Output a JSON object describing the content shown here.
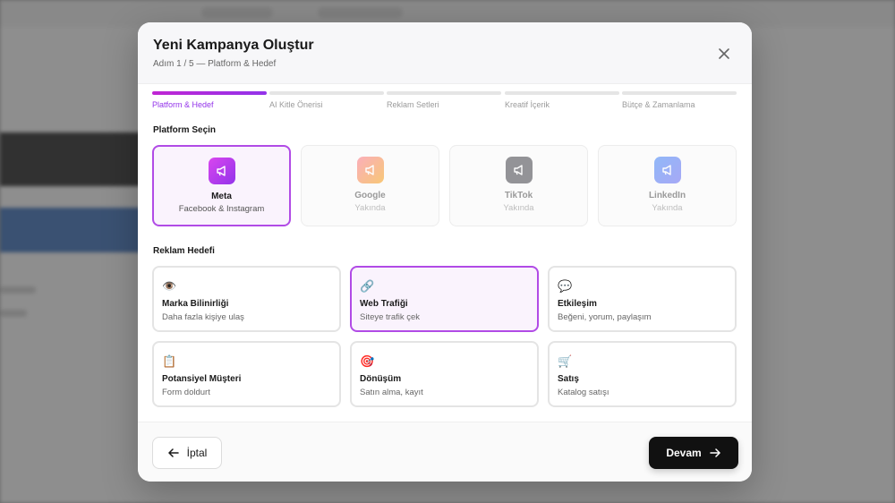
{
  "modal": {
    "title": "Yeni Kampanya Oluştur",
    "subtitle": "Adım 1 / 5 — Platform & Hedef"
  },
  "steps": [
    {
      "label": "Platform & Hedef",
      "active": true
    },
    {
      "label": "AI Kitle Önerisi",
      "active": false
    },
    {
      "label": "Reklam Setleri",
      "active": false
    },
    {
      "label": "Kreatif İçerik",
      "active": false
    },
    {
      "label": "Bütçe & Zamanlama",
      "active": false
    }
  ],
  "platform_section": {
    "title": "Platform Seçin",
    "platforms": [
      {
        "name": "Meta",
        "desc": "Facebook & Instagram",
        "icon": "megaphone-icon",
        "color": "#c026d3",
        "selected": true
      },
      {
        "name": "Google",
        "desc": "Yakında",
        "icon": "megaphone-icon",
        "color": "#f59e6b",
        "selected": false
      },
      {
        "name": "TikTok",
        "desc": "Yakında",
        "icon": "megaphone-icon",
        "color": "#3f3f46",
        "selected": false
      },
      {
        "name": "LinkedIn",
        "desc": "Yakında",
        "icon": "megaphone-icon",
        "color": "#5b7cf0",
        "selected": false
      }
    ]
  },
  "goal_section": {
    "title": "Reklam Hedefi",
    "goals": [
      {
        "name": "Marka Bilinirliği",
        "desc": "Daha fazla kişiye ulaş",
        "icon": "eye-icon",
        "glyph": "👁️",
        "selected": false
      },
      {
        "name": "Web Trafiği",
        "desc": "Siteye trafik çek",
        "icon": "link-icon",
        "glyph": "🔗",
        "selected": true
      },
      {
        "name": "Etkileşim",
        "desc": "Beğeni, yorum, paylaşım",
        "icon": "speech-bubble-icon",
        "glyph": "💬",
        "selected": false
      },
      {
        "name": "Potansiyel Müşteri",
        "desc": "Form doldurt",
        "icon": "clipboard-icon",
        "glyph": "📋",
        "selected": false
      },
      {
        "name": "Dönüşüm",
        "desc": "Satın alma, kayıt",
        "icon": "target-icon",
        "glyph": "🎯",
        "selected": false
      },
      {
        "name": "Satış",
        "desc": "Katalog satışı",
        "icon": "cart-icon",
        "glyph": "🛒",
        "selected": false
      }
    ]
  },
  "footer": {
    "cancel_label": "İptal",
    "next_label": "Devam"
  },
  "colors": {
    "accent": "#9333ea",
    "selected_border": "#b14be6",
    "primary_button": "#111111"
  }
}
